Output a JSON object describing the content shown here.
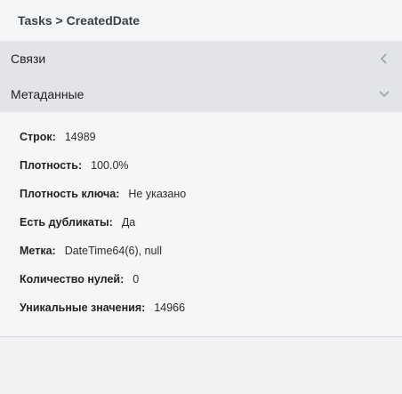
{
  "header": {
    "breadcrumb": "Tasks > CreatedDate"
  },
  "sections": [
    {
      "label": "Связи",
      "state": "collapsed",
      "icon": "chevron-left-icon"
    },
    {
      "label": "Метаданные",
      "state": "expanded",
      "icon": "chevron-down-icon"
    }
  ],
  "metadata": [
    {
      "key": "Строк:",
      "value": "14989"
    },
    {
      "key": "Плотность:",
      "value": "100.0%"
    },
    {
      "key": "Плотность ключа:",
      "value": "Не указано"
    },
    {
      "key": "Есть дубликаты:",
      "value": "Да"
    },
    {
      "key": "Метка:",
      "value": "DateTime64(6), null"
    },
    {
      "key": "Количество нулей:",
      "value": "0"
    },
    {
      "key": "Уникальные значения:",
      "value": "14966"
    }
  ]
}
